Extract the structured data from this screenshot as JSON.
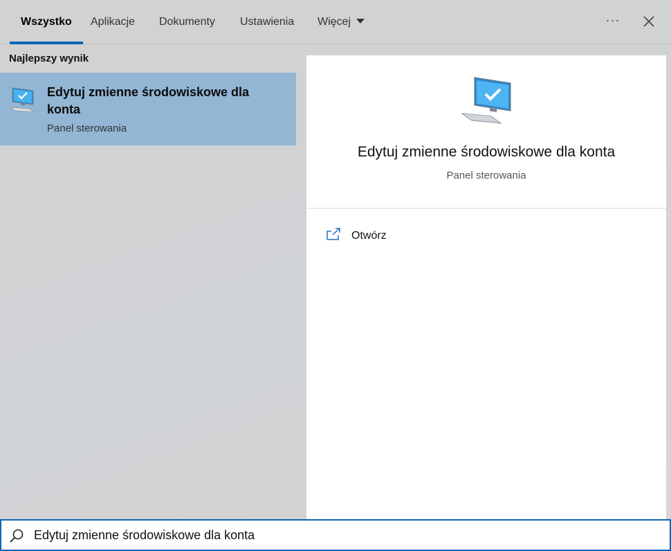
{
  "tabs": [
    {
      "label": "Wszystko",
      "active": true
    },
    {
      "label": "Aplikacje",
      "active": false
    },
    {
      "label": "Dokumenty",
      "active": false
    },
    {
      "label": "Ustawienia",
      "active": false
    },
    {
      "label": "Więcej",
      "active": false
    }
  ],
  "toolbar": {
    "more_options": "···",
    "more_options_icon": "ellipsis-icon",
    "close_icon": "close-icon"
  },
  "results": {
    "section_heading": "Najlepszy wynik",
    "best": {
      "title": "Edytuj zmienne środowiskowe dla konta",
      "subtitle": "Panel sterowania",
      "icon": "computer-check-icon"
    }
  },
  "preview": {
    "title": "Edytuj zmienne środowiskowe dla konta",
    "subtitle": "Panel sterowania",
    "icon": "computer-check-icon",
    "actions": [
      {
        "label": "Otwórz",
        "icon": "open-external-icon"
      }
    ]
  },
  "search": {
    "value": "Edytuj zmienne środowiskowe dla konta",
    "icon": "search-icon"
  },
  "colors": {
    "accent": "#0a66b8",
    "selected_background": "#92b6d4",
    "icon_blue": "#1e90d6"
  }
}
